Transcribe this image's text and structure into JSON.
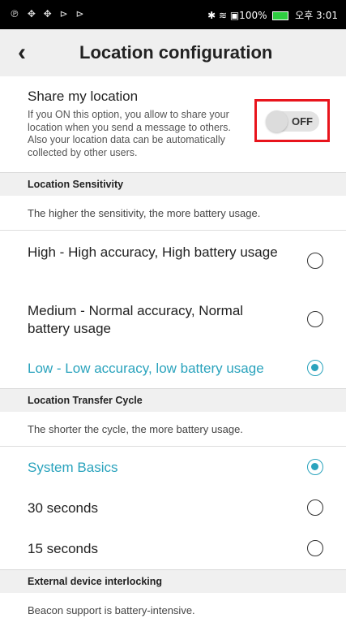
{
  "status_bar": {
    "notification_icons": "℗ ✥ ✥ ⊳ ⊳",
    "right_text": "✱ ≋ ▣100%",
    "battery_icon": "battery-icon",
    "time": "오후 3:01"
  },
  "app_bar": {
    "back_glyph": "‹",
    "title": "Location configuration"
  },
  "share": {
    "title": "Share my location",
    "description": "If you ON this option, you allow to share your location when you send a message to others. Also your location data can be automatically collected by other users.",
    "toggle_state": "OFF",
    "highlight_color": "#e8141c"
  },
  "sensitivity": {
    "header": "Location Sensitivity",
    "note": "The higher the sensitivity, the more battery usage.",
    "options": [
      {
        "label": "High - High accuracy, High battery usage",
        "selected": false
      },
      {
        "label": "Medium - Normal accuracy, Normal battery usage",
        "selected": false
      },
      {
        "label": "Low - Low accuracy, low battery usage",
        "selected": true
      }
    ]
  },
  "transfer_cycle": {
    "header": "Location Transfer Cycle",
    "note": "The shorter the cycle, the more battery usage.",
    "options": [
      {
        "label": "System Basics",
        "selected": true
      },
      {
        "label": "30 seconds",
        "selected": false
      },
      {
        "label": "15 seconds",
        "selected": false
      }
    ]
  },
  "external": {
    "header": "External device interlocking",
    "note": "Beacon support is battery-intensive."
  },
  "colors": {
    "accent": "#2aa3bd",
    "highlight": "#e8141c"
  }
}
